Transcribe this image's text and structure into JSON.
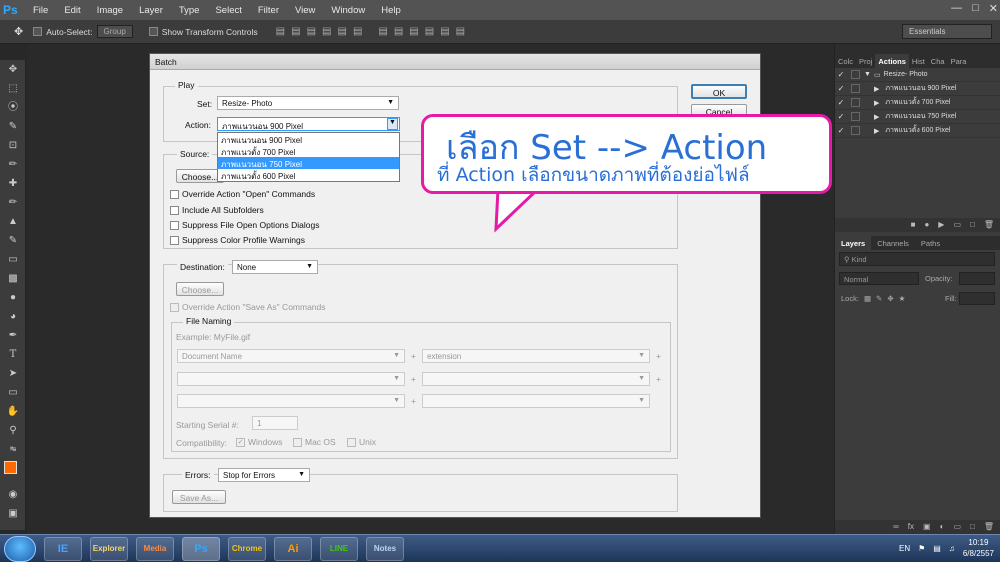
{
  "menubar": {
    "logo": "Ps",
    "items": [
      "File",
      "Edit",
      "Image",
      "Layer",
      "Type",
      "Select",
      "Filter",
      "View",
      "Window",
      "Help"
    ]
  },
  "options_bar": {
    "auto_select_label": "Auto-Select:",
    "auto_select_value": "Group",
    "show_transform_label": "Show Transform Controls",
    "workspace": "Essentials"
  },
  "actions_panel": {
    "tabs": [
      "Colc",
      "Proj",
      "Actions",
      "Hist",
      "Cha",
      "Para"
    ],
    "set_name": "Resize- Photo",
    "actions": [
      "ภาพแนวนอน 900 Pixel",
      "ภาพแนวตั้ง 700 Pixel",
      "ภาพแนวนอน 750 Pixel",
      "ภาพแนวตั้ง 600 Pixel"
    ]
  },
  "layers_panel": {
    "tabs": [
      "Layers",
      "Channels",
      "Paths"
    ],
    "kind_label": "Kind",
    "blend_mode": "Normal",
    "opacity_label": "Opacity:",
    "lock_label": "Lock:",
    "fill_label": "Fill:"
  },
  "batch": {
    "title": "Batch",
    "ok_label": "OK",
    "cancel_label": "Cancel",
    "play_group": "Play",
    "set_label": "Set:",
    "set_value": "Resize- Photo",
    "action_label": "Action:",
    "action_value": "ภาพแนวนอน 900 Pixel",
    "action_options": [
      "ภาพแนวนอน 900 Pixel",
      "ภาพแนวตั้ง 700 Pixel",
      "ภาพแนวนอน 750 Pixel",
      "ภาพแนวตั้ง 600 Pixel"
    ],
    "source_label": "Source:",
    "choose_label": "Choose...",
    "override_open": "Override Action \"Open\" Commands",
    "include_subfolders": "Include All Subfolders",
    "suppress_open": "Suppress File Open Options Dialogs",
    "suppress_color": "Suppress Color Profile Warnings",
    "destination_label": "Destination:",
    "destination_value": "None",
    "choose_dest_label": "Choose...",
    "override_save": "Override Action \"Save As\" Commands",
    "file_naming": "File Naming",
    "example": "Example: MyFile.gif",
    "naming_1": "Document Name",
    "naming_2": "extension",
    "plus": "+",
    "serial_label": "Starting Serial #:",
    "serial_value": "1",
    "compat_label": "Compatibility:",
    "compat_windows": "Windows",
    "compat_mac": "Mac OS",
    "compat_unix": "Unix",
    "errors_label": "Errors:",
    "errors_value": "Stop for Errors",
    "save_as_label": "Save As..."
  },
  "callout": {
    "line1": "เลือก Set --> Action",
    "line2": "ที่ Action เลือกขนาดภาพที่ต้องย่อไฟล์",
    "border_color": "#e51aa6",
    "text_color": "#2a6fd6"
  },
  "taskbar": {
    "apps": [
      "IE",
      "Explorer",
      "Media",
      "Ps",
      "Chrome",
      "Ai",
      "LINE",
      "Notes"
    ],
    "lang": "EN",
    "time": "10:19",
    "date": "6/8/2557"
  }
}
